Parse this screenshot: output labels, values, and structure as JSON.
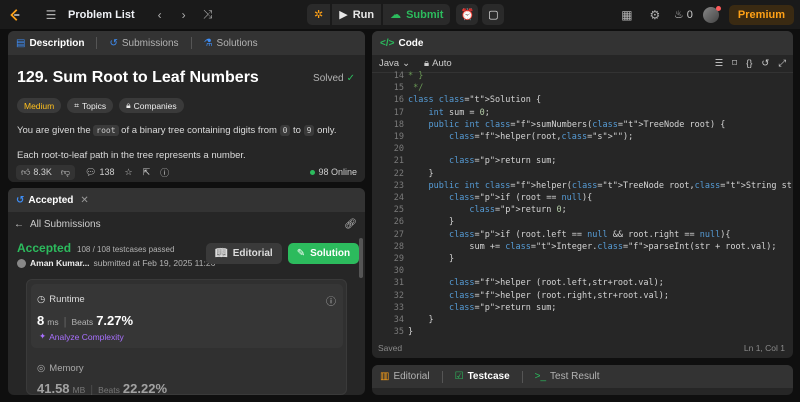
{
  "topbar": {
    "problem_list": "Problem List",
    "run": "Run",
    "submit": "Submit",
    "streak": "0",
    "premium": "Premium",
    "colors": {
      "accent": "#ffa116",
      "green": "#2cbb5d"
    }
  },
  "left": {
    "tabs": [
      {
        "label": "Description",
        "icon": "description-icon"
      },
      {
        "label": "Submissions",
        "icon": "history-icon"
      },
      {
        "label": "Solutions",
        "icon": "flask-icon"
      }
    ],
    "title": "129. Sum Root to Leaf Numbers",
    "solved": "Solved",
    "difficulty": "Medium",
    "topics": "Topics",
    "companies": "Companies",
    "desc_pre": "You are given the",
    "desc_code_root": "root",
    "desc_mid": "of a binary tree containing digits from",
    "desc_code_0": "0",
    "desc_to": "to",
    "desc_code_9": "9",
    "desc_end": "only.",
    "desc2": "Each root-to-leaf path in the tree represents a number.",
    "likes": "8.3K",
    "comments": "138",
    "online": "98 Online"
  },
  "accepted": {
    "tab": "Accepted",
    "all_submissions": "All Submissions",
    "status": "Accepted",
    "testcases": "108 / 108 testcases passed",
    "user": "Aman Kumar...",
    "submitted": "submitted at Feb 19, 2025 11:26",
    "editorial": "Editorial",
    "solution": "Solution",
    "runtime_label": "Runtime",
    "runtime_value": "8",
    "runtime_unit": "ms",
    "beats_label": "Beats",
    "runtime_beats": "7.27%",
    "analyze": "Analyze Complexity",
    "memory_label": "Memory",
    "memory_value": "41.58",
    "memory_unit": "MB",
    "memory_beats": "22.22%"
  },
  "code": {
    "tab": "Code",
    "language": "Java",
    "mode": "Auto",
    "saved": "Saved",
    "cursor": "Ln 1, Col 1",
    "line_numbers": [
      "14",
      "15",
      "16",
      "17",
      "18",
      "19",
      "20",
      "21",
      "22",
      "23",
      "24",
      "25",
      "26",
      "27",
      "28",
      "29",
      "30",
      "31",
      "32",
      "33",
      "34",
      "35"
    ],
    "lines": [
      "* }",
      " */",
      "class Solution {",
      "    int sum = 0;",
      "    public int sumNumbers(TreeNode root) {",
      "        helper(root,\"\");",
      "",
      "        return sum;",
      "    }",
      "    public int helper(TreeNode root,String str){",
      "        if (root == null){",
      "            return 0;",
      "        }",
      "        if (root.left == null && root.right == null){",
      "            sum += Integer.parseInt(str + root.val);",
      "        }",
      "",
      "        helper (root.left,str+root.val);",
      "        helper (root.right,str+root.val);",
      "        return sum;",
      "    }",
      "}"
    ]
  },
  "bottom": {
    "tabs": [
      {
        "label": "Editorial"
      },
      {
        "label": "Testcase"
      },
      {
        "label": "Test Result"
      }
    ]
  }
}
